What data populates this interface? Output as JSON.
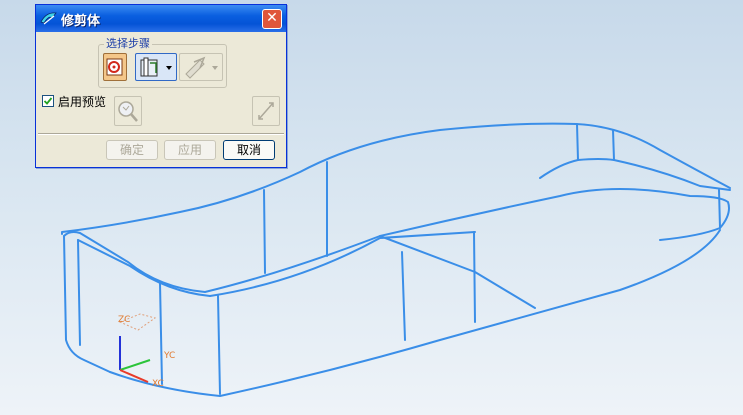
{
  "dialog": {
    "title": "修剪体",
    "close_glyph": "✕",
    "steps_group_label": "选择步骤",
    "steps": [
      {
        "icon": "select-target-body-icon",
        "state": "active"
      },
      {
        "icon": "tool-face-dropdown-icon",
        "state": "selected"
      },
      {
        "icon": "direction-dropdown-icon",
        "state": "disabled"
      }
    ],
    "preview": {
      "label": "启用预览",
      "checked": true,
      "icon": "zoom-preview-icon"
    },
    "reverse_direction_icon": "reverse-direction-icon",
    "buttons": {
      "ok": "确定",
      "apply": "应用",
      "cancel": "取消"
    }
  },
  "viewport": {
    "background": "#d2e1ee",
    "wireframe_color": "#3a8ee8",
    "csys_labels": {
      "z": "ZC",
      "y": "YC",
      "x": "XC"
    },
    "axis_colors": {
      "x": "#e83a2a",
      "y": "#2bc43a",
      "z": "#2332d8"
    },
    "label_color": "#e07a30"
  }
}
